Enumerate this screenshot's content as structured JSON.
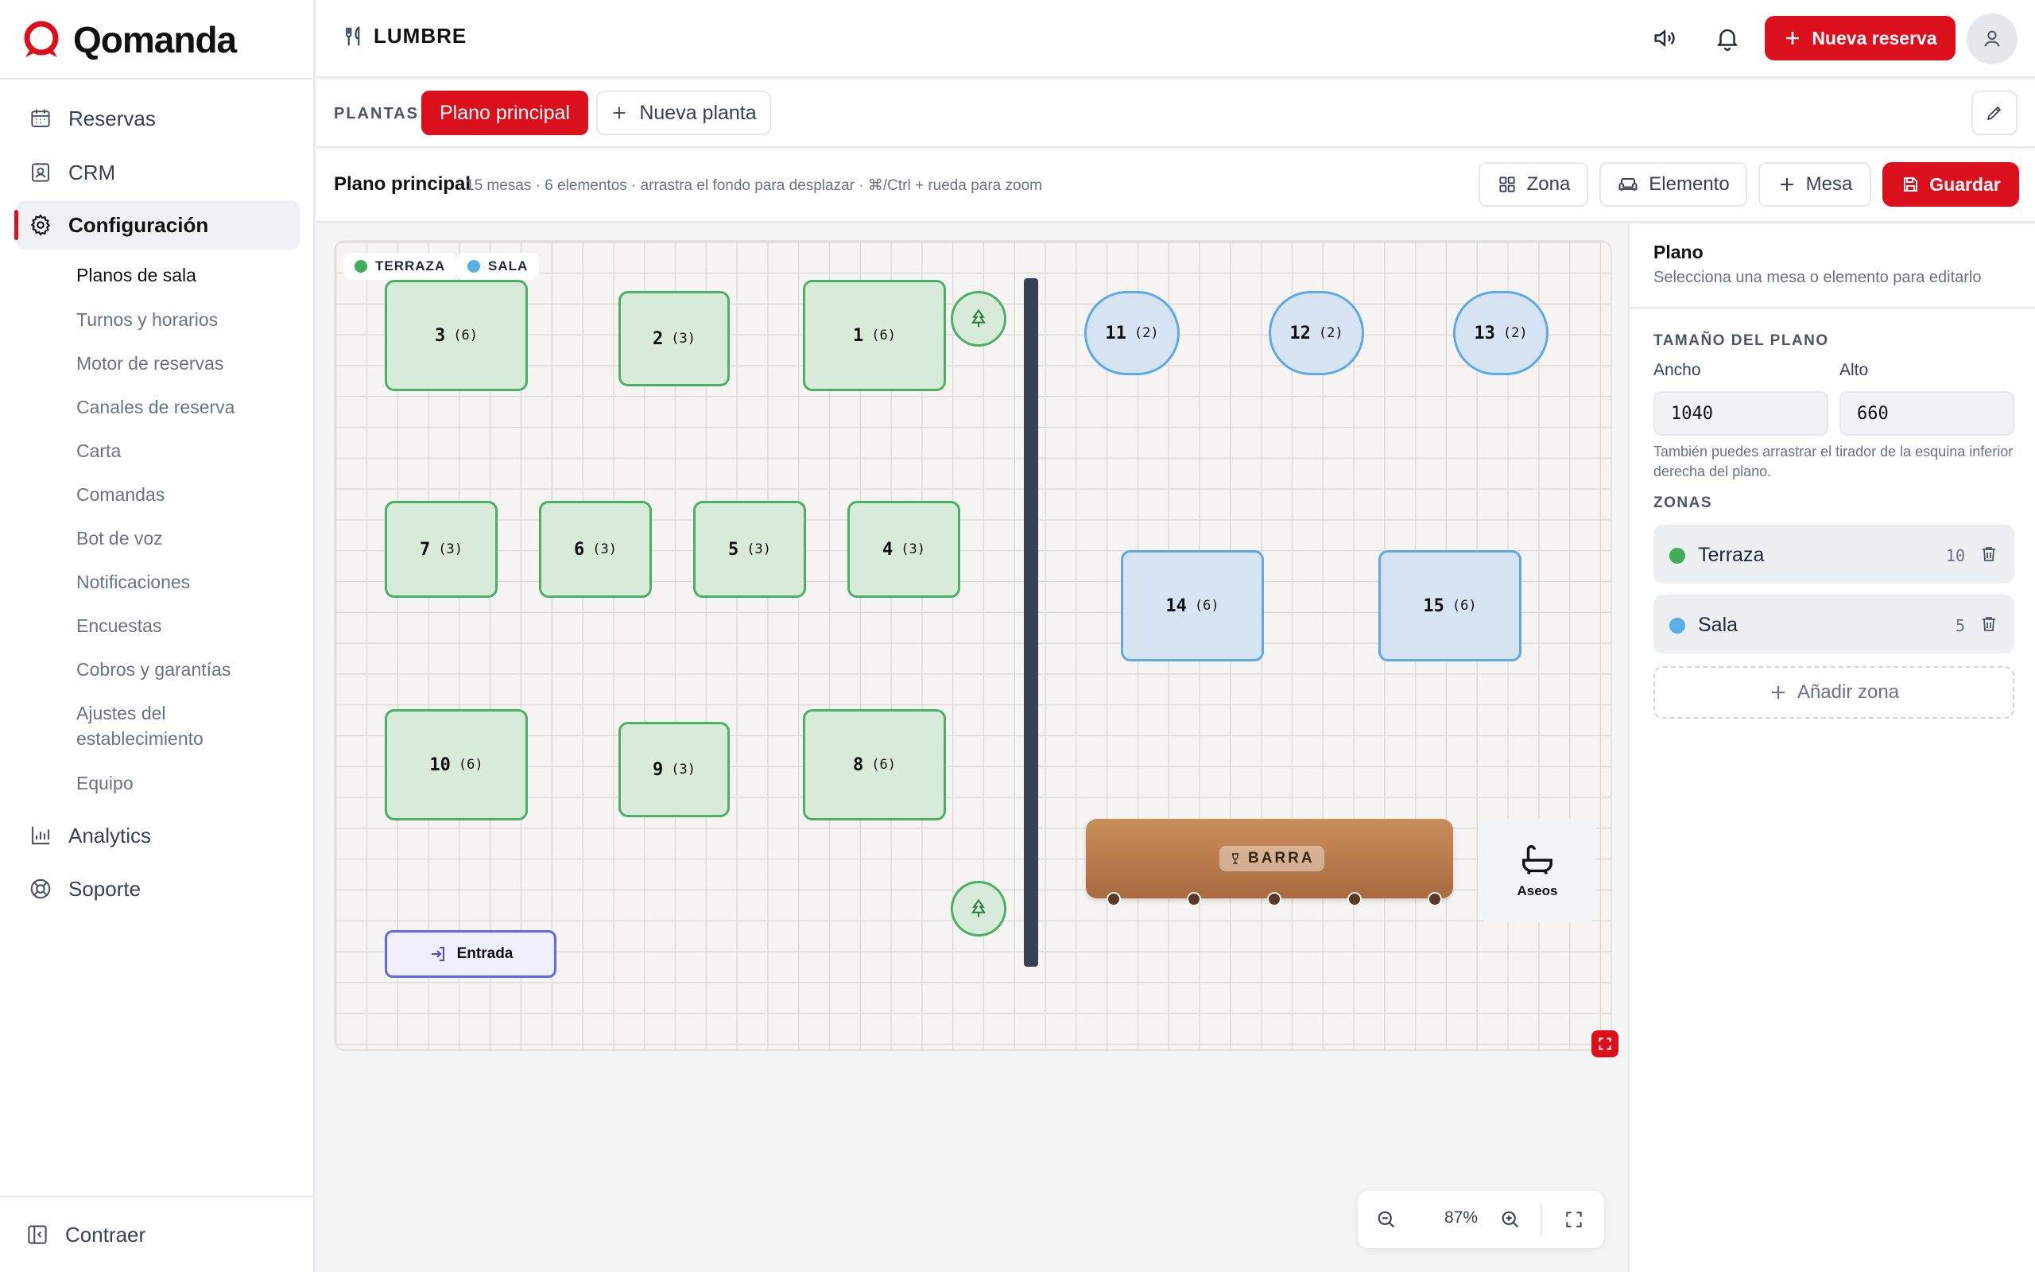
{
  "app": {
    "name": "Qomanda",
    "restaurant": "LUMBRE",
    "brand_color": "#dc0f1d"
  },
  "sidebar": {
    "items": [
      {
        "label": "Reservas",
        "icon": "calendar-icon"
      },
      {
        "label": "CRM",
        "icon": "contact-icon"
      },
      {
        "label": "Configuración",
        "icon": "gear-icon"
      },
      {
        "label": "Analytics",
        "icon": "bar-chart-icon"
      },
      {
        "label": "Soporte",
        "icon": "lifebuoy-icon"
      }
    ],
    "subitems": [
      "Planos de sala",
      "Turnos y horarios",
      "Motor de reservas",
      "Canales de reserva",
      "Carta",
      "Comandas",
      "Bot de voz",
      "Notificaciones",
      "Encuestas",
      "Cobros y garantías",
      "Ajustes del establecimiento",
      "Equipo"
    ],
    "collapse_label": "Contraer"
  },
  "header": {
    "new_reservation_label": "Nueva reserva"
  },
  "tabs": {
    "section_label": "PLANTAS",
    "active": "Plano principal",
    "new_floor": "Nueva planta"
  },
  "toolbar": {
    "plan_name": "Plano principal",
    "meta": "15 mesas · 6 elementos · arrastra el fondo para desplazar · ⌘/Ctrl + rueda para zoom",
    "zone_btn": "Zona",
    "element_btn": "Elemento",
    "table_btn": "Mesa",
    "save_btn": "Guardar"
  },
  "canvas": {
    "zones": [
      {
        "label": "TERRAZA",
        "color": "#3fae5a"
      },
      {
        "label": "SALA",
        "color": "#5aaee8"
      }
    ],
    "tables": [
      {
        "num": "3",
        "cap": "(6)",
        "zone": "terraza"
      },
      {
        "num": "2",
        "cap": "(3)",
        "zone": "terraza"
      },
      {
        "num": "1",
        "cap": "(6)",
        "zone": "terraza"
      },
      {
        "num": "11",
        "cap": "(2)",
        "zone": "sala"
      },
      {
        "num": "12",
        "cap": "(2)",
        "zone": "sala"
      },
      {
        "num": "13",
        "cap": "(2)",
        "zone": "sala"
      },
      {
        "num": "7",
        "cap": "(3)",
        "zone": "terraza"
      },
      {
        "num": "6",
        "cap": "(3)",
        "zone": "terraza"
      },
      {
        "num": "5",
        "cap": "(3)",
        "zone": "terraza"
      },
      {
        "num": "4",
        "cap": "(3)",
        "zone": "terraza"
      },
      {
        "num": "14",
        "cap": "(6)",
        "zone": "sala"
      },
      {
        "num": "15",
        "cap": "(6)",
        "zone": "sala"
      },
      {
        "num": "10",
        "cap": "(6)",
        "zone": "terraza"
      },
      {
        "num": "9",
        "cap": "(3)",
        "zone": "terraza"
      },
      {
        "num": "8",
        "cap": "(6)",
        "zone": "terraza"
      }
    ],
    "bar_label": "BARRA",
    "restroom_label": "Aseos",
    "entrance_label": "Entrada"
  },
  "zoom": {
    "value": "87%"
  },
  "panel": {
    "title": "Plano",
    "subtitle": "Selecciona una mesa o elemento para editarlo",
    "size_section": "TAMAÑO DEL PLANO",
    "width_label": "Ancho",
    "width_value": "1040",
    "height_label": "Alto",
    "height_value": "660",
    "help": "También puedes arrastrar el tirador de la esquina inferior derecha del plano.",
    "zones_section": "ZONAS",
    "zones": [
      {
        "name": "Terraza",
        "count": "10",
        "color": "#3fae5a"
      },
      {
        "name": "Sala",
        "count": "5",
        "color": "#5aaee8"
      }
    ],
    "add_zone": "Añadir zona"
  }
}
